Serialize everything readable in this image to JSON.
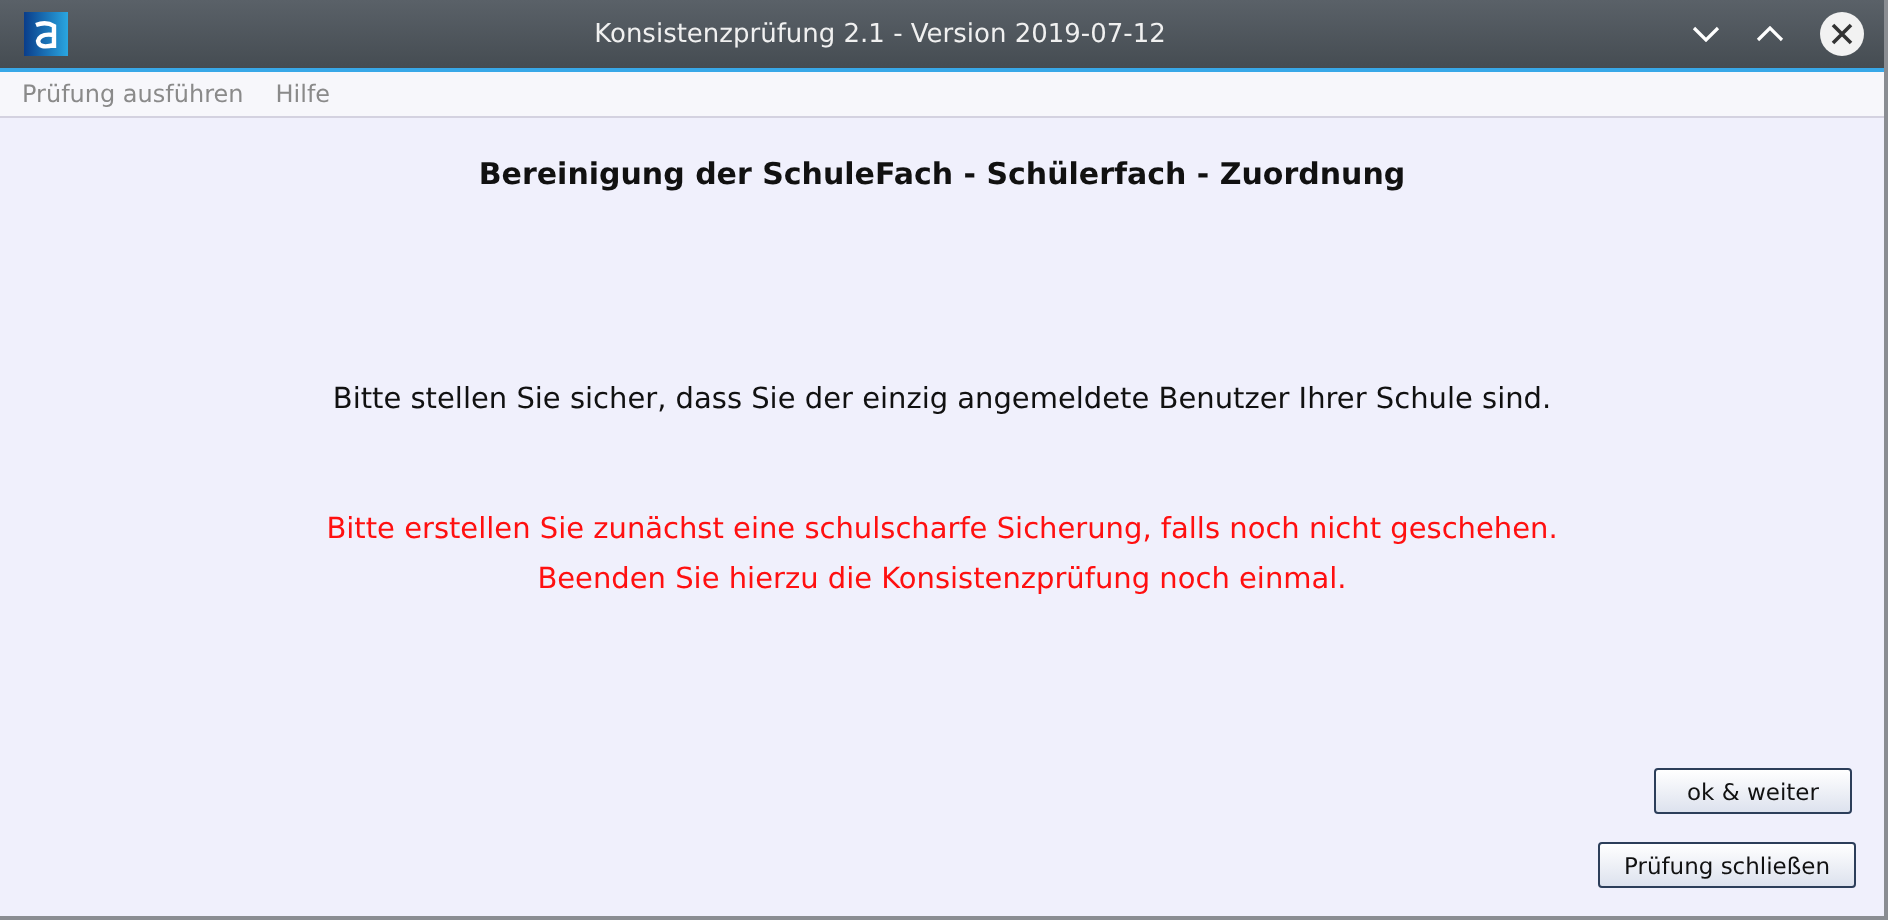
{
  "window": {
    "title": "Konsistenzprüfung 2.1 - Version 2019-07-12"
  },
  "menu": [
    {
      "label": "Prüfung ausführen",
      "disabled": true
    },
    {
      "label": "Hilfe",
      "disabled": true
    }
  ],
  "heading": "Bereinigung der SchuleFach - Schülerfach - Zuordnung",
  "message": "Bitte stellen Sie sicher, dass Sie der einzig angemeldete Benutzer Ihrer Schule sind.",
  "warning": [
    "Bitte erstellen Sie zunächst eine schulscharfe Sicherung, falls noch nicht geschehen.",
    "Beenden Sie hierzu die Konsistenzprüfung noch einmal."
  ],
  "buttons": [
    "ok & weiter",
    "Prüfung schließen"
  ]
}
